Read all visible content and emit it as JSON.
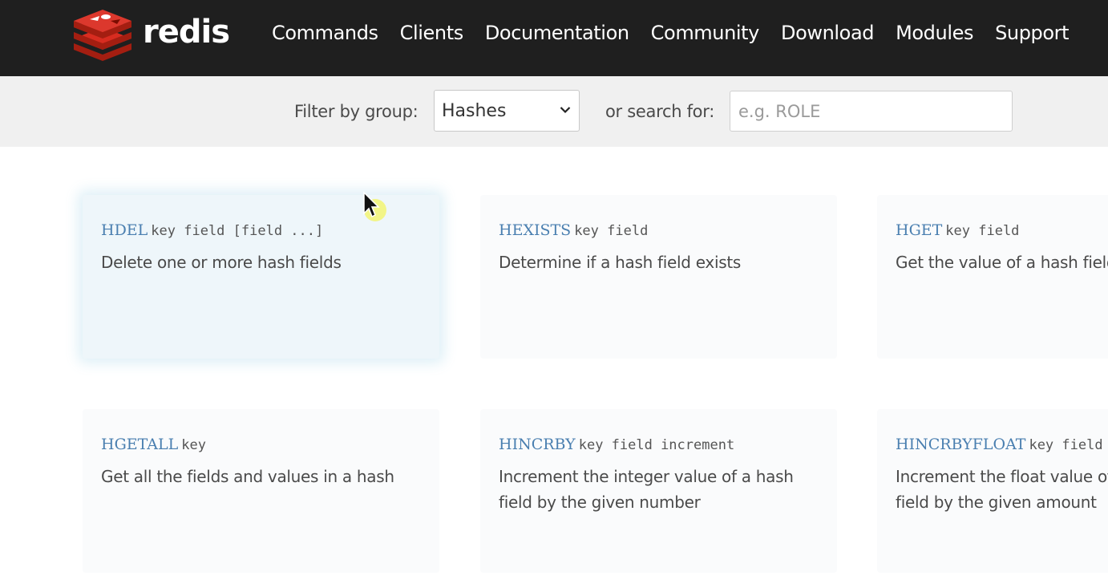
{
  "brand": {
    "name": "redis",
    "logo_icon": "redis-cube-logo-icon",
    "colors": {
      "header_bg": "#1f1f1f",
      "logo_red": "#d82c20",
      "command_blue": "#4a7fb0",
      "filter_bg": "#f0f0f0"
    }
  },
  "nav": {
    "items": [
      {
        "label": "Commands"
      },
      {
        "label": "Clients"
      },
      {
        "label": "Documentation"
      },
      {
        "label": "Community"
      },
      {
        "label": "Download"
      },
      {
        "label": "Modules"
      },
      {
        "label": "Support"
      }
    ]
  },
  "filter": {
    "group_label": "Filter by group:",
    "group_selected": "Hashes",
    "search_label": "or search for:",
    "search_placeholder": "e.g. ROLE",
    "search_value": ""
  },
  "commands": [
    {
      "name": "HDEL",
      "args": "key field [field ...]",
      "summary": "Delete one or more hash fields"
    },
    {
      "name": "HEXISTS",
      "args": "key field",
      "summary": "Determine if a hash field exists"
    },
    {
      "name": "HGET",
      "args": "key field",
      "summary": "Get the value of a hash field"
    },
    {
      "name": "HGETALL",
      "args": "key",
      "summary": "Get all the fields and values in a hash"
    },
    {
      "name": "HINCRBY",
      "args": "key field increment",
      "summary": "Increment the integer value of a hash field by the given number"
    },
    {
      "name": "HINCRBYFLOAT",
      "args": "key field increment",
      "summary": "Increment the float value of a hash field by the given amount"
    }
  ]
}
